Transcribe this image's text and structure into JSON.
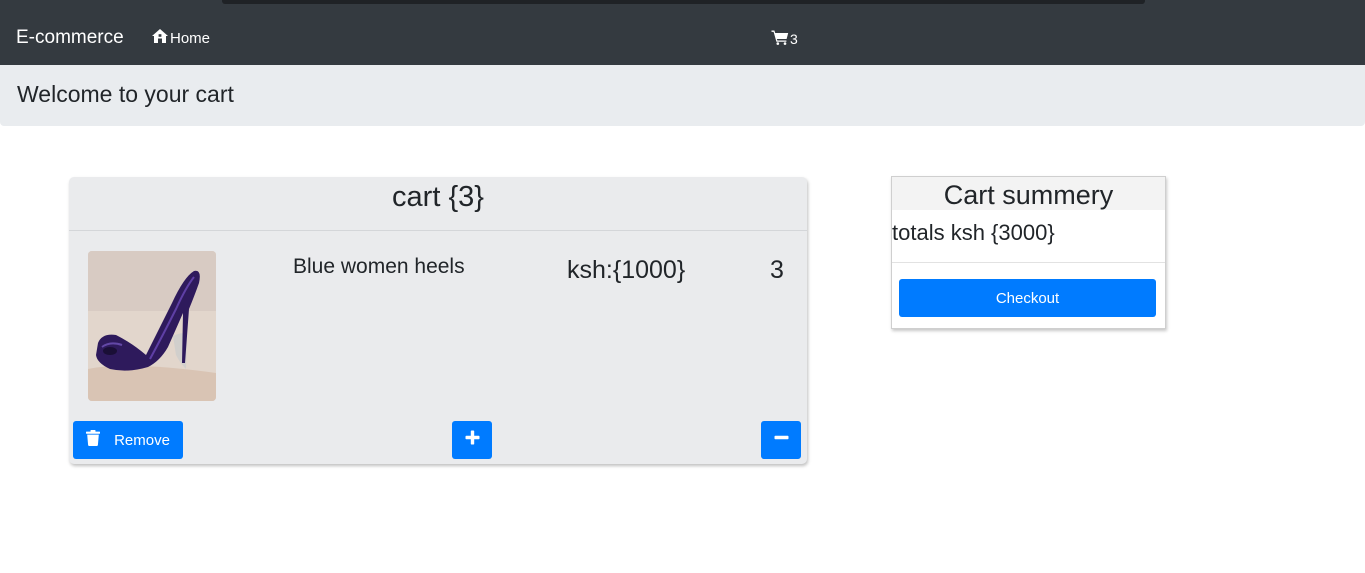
{
  "navbar": {
    "brand": "E-commerce",
    "home_label": "Home",
    "home_icon": "home-icon",
    "cart_icon": "shopping-cart-icon",
    "cart_count": "3",
    "background": "#343a40"
  },
  "jumbotron": {
    "title": "Welcome to your cart"
  },
  "cart": {
    "title": "cart {3}",
    "items": [
      {
        "name": "Blue women heels",
        "price": "ksh:{1000}",
        "quantity": "3",
        "image": "product-photo-purple-heels",
        "remove_label": "Remove",
        "remove_icon": "trash-icon",
        "increase_icon": "plus-icon",
        "decrease_icon": "minus-icon"
      }
    ]
  },
  "summary": {
    "title": "Cart summery",
    "total": "totals ksh {3000}",
    "checkout_label": "Checkout"
  },
  "colors": {
    "primary": "#007bff",
    "card_bg": "#eaebed",
    "jumbotron_bg": "#e9ecef"
  }
}
